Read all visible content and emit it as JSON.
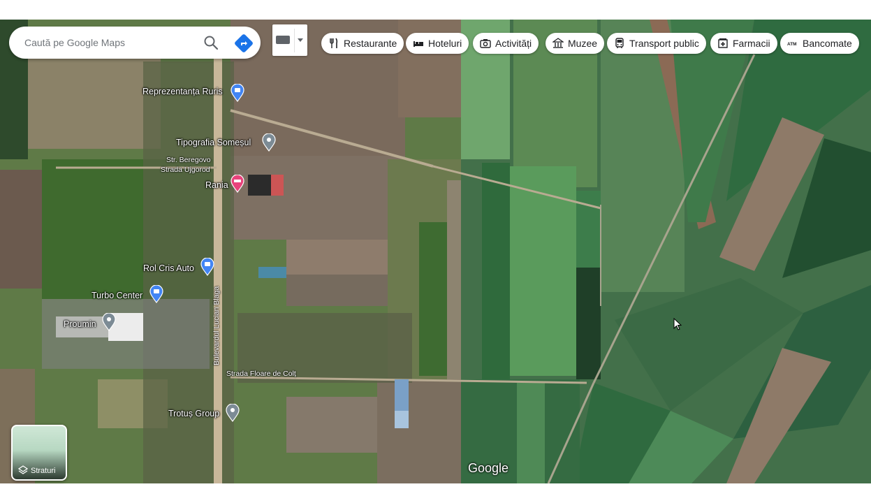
{
  "search": {
    "placeholder": "Caută pe Google Maps"
  },
  "categories": [
    {
      "label": "Restaurante",
      "icon": "fork-knife-icon"
    },
    {
      "label": "Hoteluri",
      "icon": "bed-icon"
    },
    {
      "label": "Activități",
      "icon": "camera-icon"
    },
    {
      "label": "Muzee",
      "icon": "museum-icon"
    },
    {
      "label": "Transport public",
      "icon": "bus-icon"
    },
    {
      "label": "Farmacii",
      "icon": "pharmacy-icon"
    },
    {
      "label": "Bancomate",
      "icon": "atm-icon"
    }
  ],
  "places": [
    {
      "name": "Reprezentanța Ruris",
      "icon": "shopping-bag-pin-icon"
    },
    {
      "name": "Tipografia Someșul",
      "icon": "generic-pin-icon"
    },
    {
      "name": "Rania",
      "icon": "hotel-pin-icon"
    },
    {
      "name": "Rol Cris Auto",
      "icon": "shopping-bag-pin-icon"
    },
    {
      "name": "Turbo Center",
      "icon": "shopping-bag-pin-icon"
    },
    {
      "name": "Proumin",
      "icon": "generic-pin-icon"
    },
    {
      "name": "Trotuș Group",
      "icon": "generic-pin-icon"
    }
  ],
  "streets": {
    "beregovo": "Str. Beregovo",
    "ujgorod": "Strada Ujgorod",
    "blaga": "Bulevardul Lucian Blaga",
    "floare": "Strada Floare de Colț"
  },
  "layers": {
    "label": "Straturi"
  },
  "brand": {
    "logo_text": "Google"
  },
  "colors": {
    "accent_blue": "#1a73e8",
    "pin_blue": "#4285f4",
    "pin_pink": "#e8437c",
    "pin_gray": "#7c8b95"
  }
}
